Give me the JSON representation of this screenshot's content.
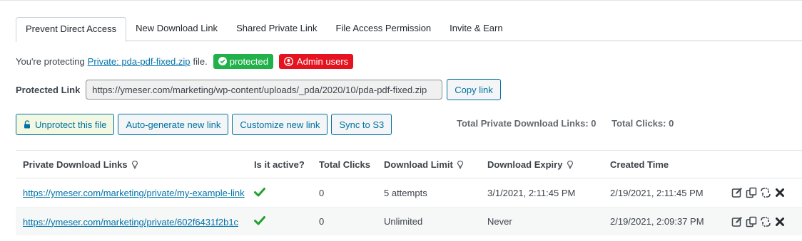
{
  "tabs": [
    {
      "label": "Prevent Direct Access",
      "active": true
    },
    {
      "label": "New Download Link"
    },
    {
      "label": "Shared Private Link"
    },
    {
      "label": "File Access Permission"
    },
    {
      "label": "Invite & Earn"
    }
  ],
  "protecting": {
    "prefix": "You're protecting",
    "file_link": "Private: pda-pdf-fixed.zip",
    "suffix": "file.",
    "badge_protected": "protected",
    "badge_admin": "Admin users"
  },
  "protected_link": {
    "label": "Protected Link",
    "value": "https://ymeser.com/marketing/wp-content/uploads/_pda/2020/10/pda-pdf-fixed.zip",
    "copy_label": "Copy link"
  },
  "actions": {
    "unprotect": "Unprotect this file",
    "auto_generate": "Auto-generate new link",
    "customize": "Customize new link",
    "sync": "Sync to S3"
  },
  "totals": {
    "private_links": "Total Private Download Links: 0",
    "clicks": "Total Clicks: 0"
  },
  "table": {
    "headers": {
      "links": "Private Download Links",
      "active": "Is it active?",
      "clicks": "Total Clicks",
      "limit": "Download Limit",
      "expiry": "Download Expiry",
      "created": "Created Time"
    },
    "rows": [
      {
        "link": "https://ymeser.com/marketing/private/my-example-link",
        "clicks": "0",
        "limit": "5 attempts",
        "expiry": "3/1/2021, 2:11:45 PM",
        "created": "2/19/2021, 2:11:45 PM"
      },
      {
        "link": "https://ymeser.com/marketing/private/602f6431f2b1c",
        "clicks": "0",
        "limit": "Unlimited",
        "expiry": "Never",
        "created": "2/19/2021, 2:09:37 PM"
      }
    ]
  },
  "colors": {
    "accent": "#0071a1",
    "green": "#21b14a",
    "red": "#e4131f"
  }
}
